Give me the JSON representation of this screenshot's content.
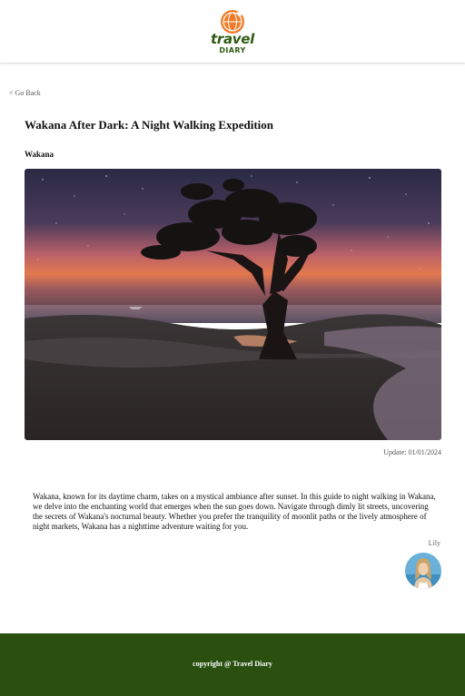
{
  "header": {
    "logo_title": "travel",
    "logo_subtitle": "DIARY"
  },
  "nav": {
    "back_label": "< Go Back"
  },
  "article": {
    "title": "Wakana After Dark: A Night Walking Expedition",
    "location": "Wakana",
    "update_label": "Update: 01/01/2024",
    "body": "Wakana, known for its daytime charm, takes on a mystical ambiance after sunset. In this guide to night walking in Wakana, we delve into the enchanting world that emerges when the sun goes down. Navigate through dimly lit streets, uncovering the secrets of Wakana's nocturnal beauty. Whether you prefer the tranquility of moonlit paths or the lively atmosphere of night markets, Wakana has a nighttime adventure waiting for you.",
    "author": "Lily"
  },
  "footer": {
    "copyright": "copyright @ Travel Diary"
  },
  "colors": {
    "brand_green": "#2e5a12",
    "footer_green": "#2a5010",
    "logo_orange": "#f07b2a"
  }
}
